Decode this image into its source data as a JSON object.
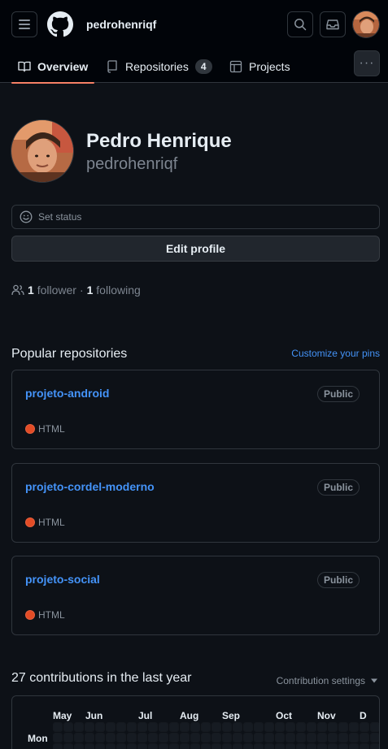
{
  "header": {
    "username": "pedrohenriqf"
  },
  "tabs": [
    {
      "label": "Overview",
      "active": true
    },
    {
      "label": "Repositories",
      "count": "4"
    },
    {
      "label": "Projects"
    }
  ],
  "more_label": "···",
  "profile": {
    "name": "Pedro Henrique",
    "login": "pedrohenriqf",
    "set_status": "Set status",
    "edit_profile": "Edit profile",
    "followers_count": "1",
    "followers_label": "follower",
    "separator": "·",
    "following_count": "1",
    "following_label": "following"
  },
  "popular": {
    "title": "Popular repositories",
    "customize": "Customize your pins",
    "repos": [
      {
        "name": "projeto-android",
        "visibility": "Public",
        "language": "HTML",
        "lang_color": "#e34c26"
      },
      {
        "name": "projeto-cordel-moderno",
        "visibility": "Public",
        "language": "HTML",
        "lang_color": "#e34c26"
      },
      {
        "name": "projeto-social",
        "visibility": "Public",
        "language": "HTML",
        "lang_color": "#e34c26"
      }
    ]
  },
  "contributions": {
    "title": "27 contributions in the last year",
    "settings": "Contribution settings",
    "months": [
      "May",
      "Jun",
      "Jul",
      "Aug",
      "Sep",
      "Oct",
      "Nov",
      "D"
    ],
    "day_label": "Mon"
  },
  "colors": {
    "accent": "#f78166",
    "link": "#4493f8",
    "html": "#e34c26",
    "bg": "#0d1117"
  }
}
